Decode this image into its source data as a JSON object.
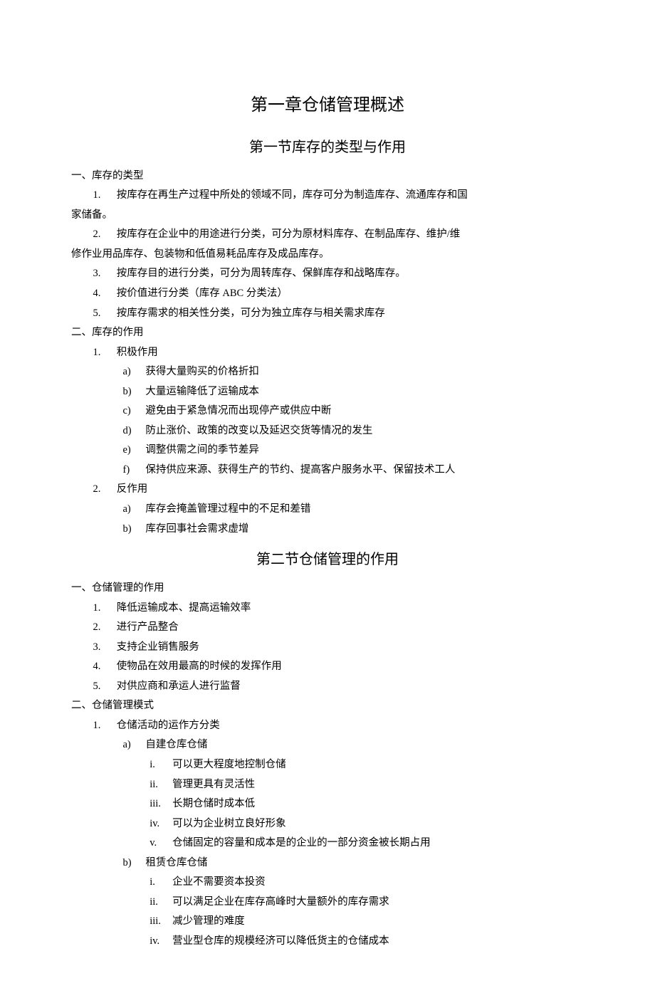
{
  "chapter_title": "第一章仓储管理概述",
  "section1": {
    "title": "第一节库存的类型与作用",
    "h1": "一、库存的类型",
    "items1": [
      "按库存在再生产过程中所处的领域不同，库存可分为制造库存、流通库存和国",
      "按库存在企业中的用途进行分类，可分为原材料库存、在制品库存、维护/维",
      "按库存目的进行分类，可分为周转库存、保鲜库存和战略库存。",
      "按价值进行分类（库存 ABC 分类法）",
      "按库存需求的相关性分类，可分为独立库存与相关需求库存"
    ],
    "cont1": "家储备。",
    "cont2": "修作业用品库存、包装物和低值易耗品库存及成品库存。",
    "h2": "二、库存的作用",
    "pos_label": "积极作用",
    "pos_items": [
      "获得大量购买的价格折扣",
      "大量运输降低了运输成本",
      "避免由于紧急情况而出现停产或供应中断",
      "防止涨价、政策的改变以及延迟交货等情况的发生",
      "调整供需之间的季节差异",
      "保持供应来源、获得生产的节约、提高客户服务水平、保留技术工人"
    ],
    "neg_label": "反作用",
    "neg_items": [
      "库存会掩盖管理过程中的不足和差错",
      "库存回事社会需求虚增"
    ]
  },
  "section2": {
    "title": "第二节仓储管理的作用",
    "h1": "一、仓储管理的作用",
    "items1": [
      "降低运输成本、提高运输效率",
      "进行产品整合",
      "支持企业销售服务",
      "使物品在效用最高的时候的发挥作用",
      "对供应商和承运人进行监督"
    ],
    "h2": "二、仓储管理模式",
    "mode_label": "仓储活动的运作方分类",
    "mode_a_label": "自建仓库仓储",
    "mode_a_items": [
      "可以更大程度地控制仓储",
      "管理更具有灵活性",
      "长期仓储时成本低",
      "可以为企业树立良好形象",
      "仓储固定的容量和成本是的企业的一部分资金被长期占用"
    ],
    "mode_b_label": "租赁仓库仓储",
    "mode_b_items": [
      "企业不需要资本投资",
      "可以满足企业在库存高峰时大量额外的库存需求",
      "减少管理的难度",
      "营业型仓库的规模经济可以降低货主的仓储成本"
    ]
  },
  "markers": {
    "num": [
      "1.",
      "2.",
      "3.",
      "4.",
      "5."
    ],
    "alpha": [
      "a)",
      "b)",
      "c)",
      "d)",
      "e)",
      "f)"
    ],
    "roman": [
      "i.",
      "ii.",
      "iii.",
      "iv.",
      "v."
    ]
  }
}
